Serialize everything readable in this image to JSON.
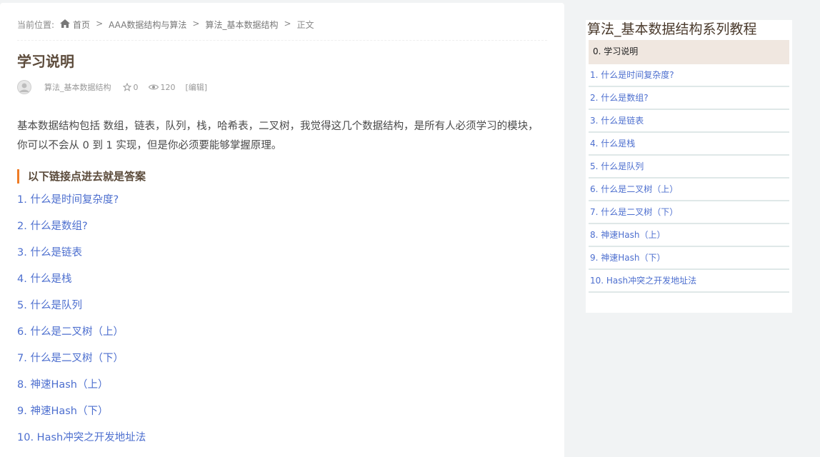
{
  "breadcrumb": {
    "label": "当前位置:",
    "home_icon": "home-icon",
    "home": "首页",
    "sep": ">",
    "items": [
      "AAA数据结构与算法",
      "算法_基本数据结构",
      "正文"
    ]
  },
  "article": {
    "title": "学习说明",
    "meta": {
      "avatar_icon": "avatar-icon",
      "category": "算法_基本数据结构",
      "star_icon": "star-icon",
      "likes": "0",
      "eye_icon": "eye-icon",
      "views": "120",
      "edit": "[编辑]"
    },
    "intro": "基本数据结构包括 数组，链表，队列，栈，哈希表，二叉树，我觉得这几个数据结构，是所有人必须学习的模块，你可以不会从 0 到 1 实现，但是你必须要能够掌握原理。",
    "section_heading": "以下链接点进去就是答案",
    "links": [
      "1. 什么是时间复杂度?",
      "2. 什么是数组?",
      "3. 什么是链表",
      "4. 什么是栈",
      "5. 什么是队列",
      "6. 什么是二叉树（上）",
      "7. 什么是二叉树（下）",
      "8. 神速Hash（上）",
      "9. 神速Hash（下）",
      "10. Hash冲突之开发地址法"
    ]
  },
  "sidebar": {
    "title": "算法_基本数据结构系列教程",
    "active": "0. 学习说明",
    "items": [
      "1. 什么是时间复杂度?",
      "2. 什么是数组?",
      "3. 什么是链表",
      "4. 什么是栈",
      "5. 什么是队列",
      "6. 什么是二叉树（上）",
      "7. 什么是二叉树（下）",
      "8. 神速Hash（上）",
      "9. 神速Hash（下）",
      "10. Hash冲突之开发地址法"
    ]
  },
  "colors": {
    "link": "#4d6fcf",
    "accent": "#ef7c26",
    "title": "#5c4b3b",
    "active_bg": "#f0e7e0",
    "page_bg": "#f1f3f4"
  }
}
